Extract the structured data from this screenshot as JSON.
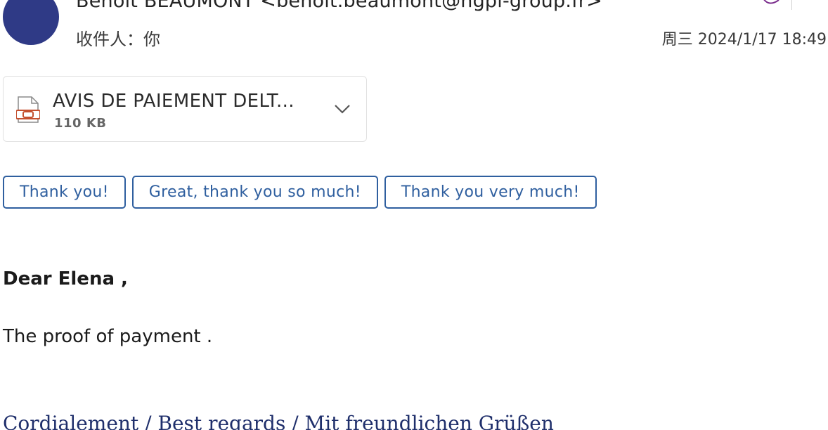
{
  "header": {
    "sender": "Benoît BEAUMONT <benoit.beaumont@ngpi-group.fr>",
    "recipient": "收件人：你",
    "datetime": "周三 2024/1/17 18:49",
    "avatar_color": "#2f3a86",
    "icons": [
      "reply-icon",
      "more-icon"
    ]
  },
  "attachment": {
    "name": "AVIS DE PAIEMENT DELT...",
    "size": "110 KB",
    "file_icon": "pdf-file-icon",
    "menu_icon": "chevron-down-icon",
    "accent": "#c4502f"
  },
  "quick_replies": [
    {
      "label": "Thank you!"
    },
    {
      "label": "Great, thank you so much!"
    },
    {
      "label": "Thank you very much!"
    }
  ],
  "message": {
    "greeting": "Dear Elena ,",
    "body": "The proof of payment .",
    "signature": "Cordialement / Best regards / Mit freundlichen Grüßen"
  },
  "colors": {
    "button_border": "#2f5f9f",
    "signature": "#1f2f6b"
  }
}
